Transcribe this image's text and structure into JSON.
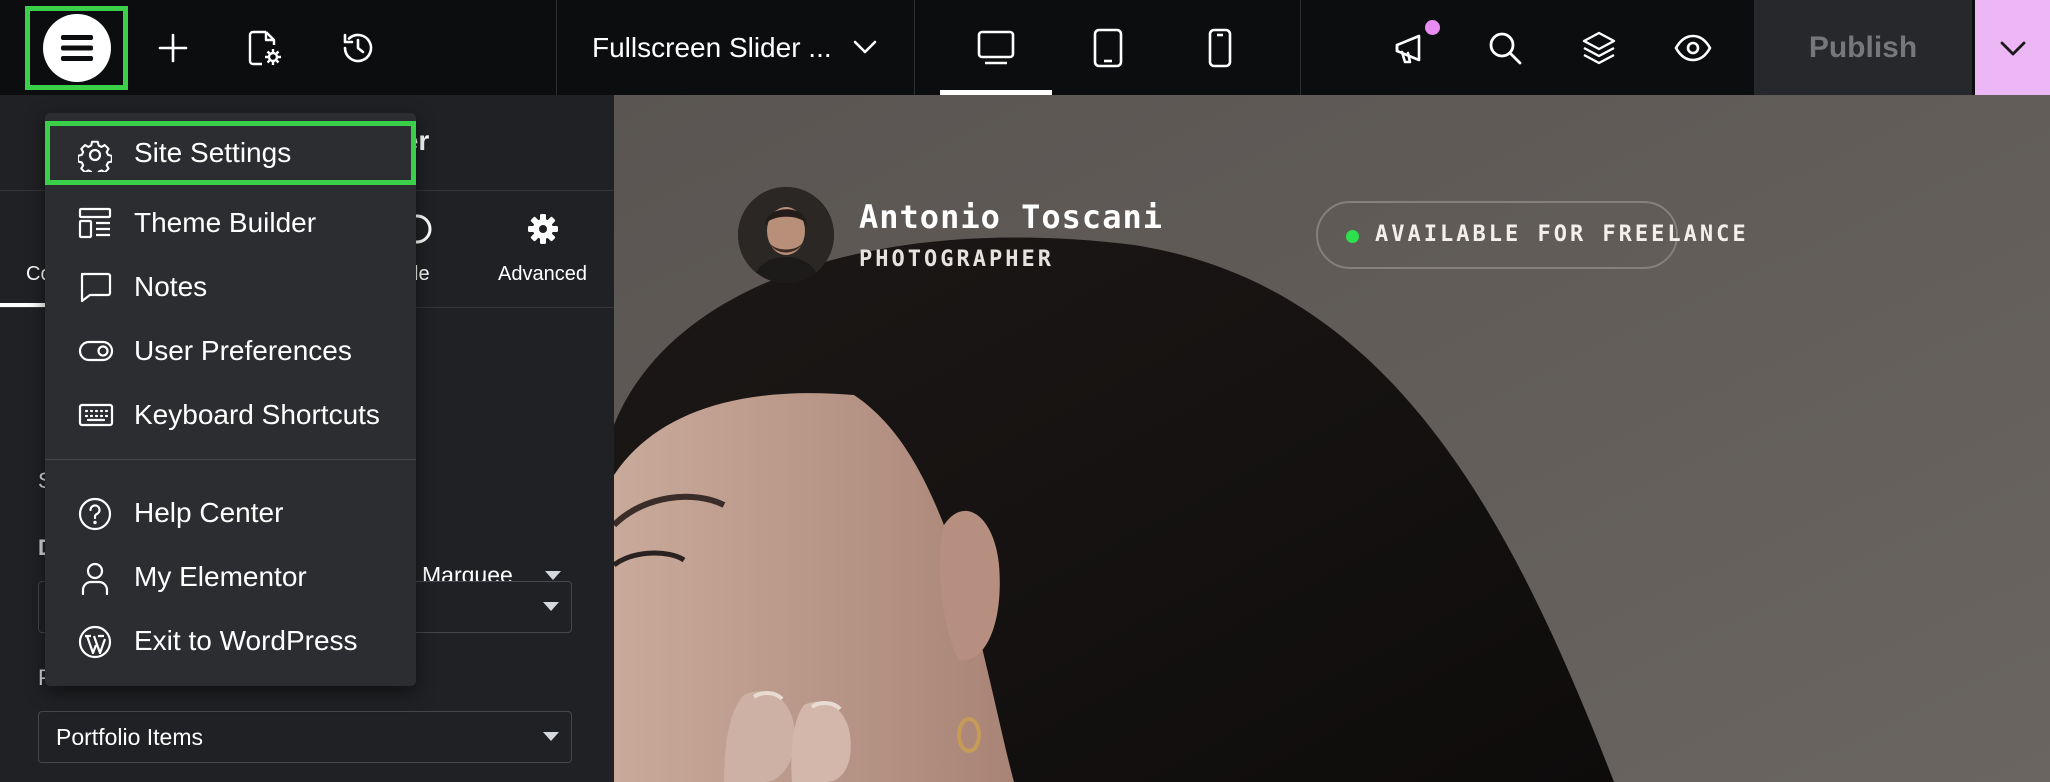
{
  "topbar": {
    "document_title": "Fullscreen Slider ...",
    "publish_label": "Publish",
    "colors": {
      "highlight": "#3bd04a",
      "accent": "#ecb7f4",
      "notification": "#e88cf2"
    },
    "icons": [
      "menu-icon",
      "plus-icon",
      "page-settings-icon",
      "history-icon",
      "chevron-down-icon",
      "desktop-icon",
      "tablet-icon",
      "mobile-icon",
      "megaphone-icon",
      "search-icon",
      "layers-icon",
      "eye-icon"
    ]
  },
  "panel": {
    "title_fragment": "ler",
    "tabs": {
      "content_fragment": "Co",
      "style_fragment": "yle",
      "advanced": "Advanced"
    },
    "fragments": {
      "f1": "S",
      "f2": "D",
      "f3": "P"
    },
    "marquee_value": "Marquee",
    "portfolio_select": "Portfolio Items"
  },
  "menu": {
    "items": [
      {
        "label": "Site Settings",
        "icon": "gear-icon"
      },
      {
        "label": "Theme Builder",
        "icon": "theme-builder-icon"
      },
      {
        "label": "Notes",
        "icon": "speech-bubble-icon"
      },
      {
        "label": "User Preferences",
        "icon": "toggle-icon"
      },
      {
        "label": "Keyboard Shortcuts",
        "icon": "keyboard-icon"
      },
      {
        "label": "Help Center",
        "icon": "help-circle-icon"
      },
      {
        "label": "My Elementor",
        "icon": "user-icon"
      },
      {
        "label": "Exit to WordPress",
        "icon": "wordpress-icon"
      }
    ]
  },
  "canvas": {
    "author_name": "Antonio Toscani",
    "author_role": "PHOTOGRAPHER",
    "availability": "AVAILABLE FOR FREELANCE",
    "availability_dot_color": "#2ee04d"
  }
}
